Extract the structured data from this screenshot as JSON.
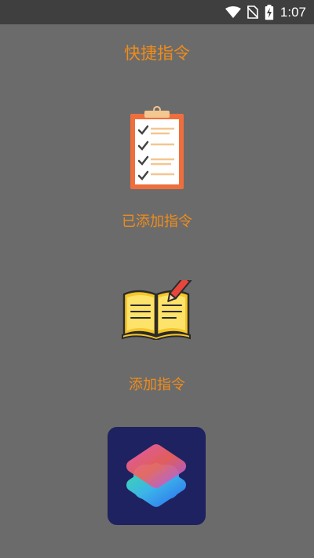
{
  "status_bar": {
    "time": "1:07",
    "icons": [
      "wifi-icon",
      "no-sim-icon",
      "battery-charging-icon"
    ],
    "bg_color": "#3f3f3f"
  },
  "page": {
    "title": "快捷指令",
    "accent_color": "#f08c1a",
    "bg_color": "#6b6b6b"
  },
  "menu": {
    "added_shortcuts": {
      "label": "已添加指令",
      "icon": "clipboard-checklist-icon"
    },
    "add_shortcut": {
      "label": "添加指令",
      "icon": "open-book-pencil-icon"
    },
    "shortcuts_app": {
      "icon": "shortcuts-app-icon",
      "bg_color": "#1f2260"
    }
  }
}
